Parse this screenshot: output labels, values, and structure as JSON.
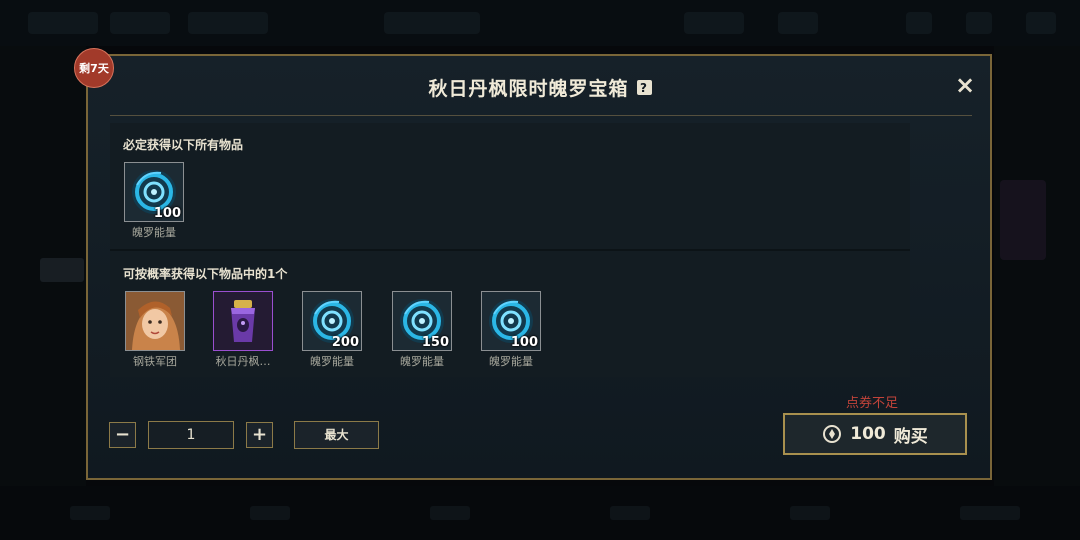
{
  "modal": {
    "badge": "剩7天",
    "title": "秋日丹枫限时魄罗宝箱",
    "help_icon": "?",
    "close_icon": "×"
  },
  "guaranteed": {
    "label": "必定获得以下所有物品",
    "items": [
      {
        "name": "魄罗能量",
        "qty": "100",
        "icon": "poro-energy-icon"
      }
    ]
  },
  "chance": {
    "label": "可按概率获得以下物品中的1个",
    "items": [
      {
        "name": "钢铁军团",
        "qty": "",
        "icon": "champion-portrait-icon"
      },
      {
        "name": "秋日丹枫…",
        "qty": "",
        "icon": "purple-crate-icon"
      },
      {
        "name": "魄罗能量",
        "qty": "200",
        "icon": "poro-energy-icon"
      },
      {
        "name": "魄罗能量",
        "qty": "150",
        "icon": "poro-energy-icon"
      },
      {
        "name": "魄罗能量",
        "qty": "100",
        "icon": "poro-energy-icon"
      }
    ]
  },
  "controls": {
    "minus": "−",
    "quantity": "1",
    "plus": "+",
    "max_label": "最大"
  },
  "purchase": {
    "warning": "点券不足",
    "price": "100",
    "buy_label": "购买",
    "currency_icon": "coupon-icon"
  },
  "colors": {
    "accent_gold": "#a8904e",
    "warning_red": "#c2433a",
    "badge_red": "#a23a2a",
    "rare_purple": "#9a4fd0"
  }
}
